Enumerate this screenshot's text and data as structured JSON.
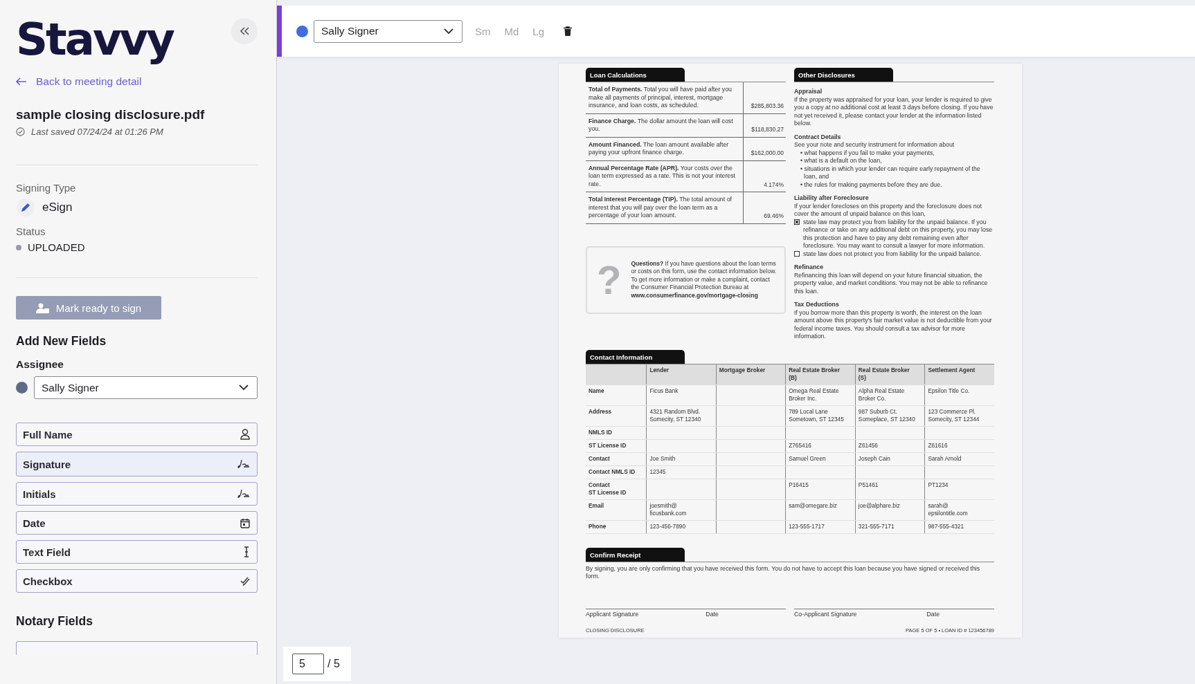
{
  "sidebar": {
    "logo": "Stavvy",
    "back_link": "Back to meeting detail",
    "document_name": "sample closing disclosure.pdf",
    "last_saved": "Last saved 07/24/24 at 01:26 PM",
    "signing_type_label": "Signing Type",
    "signing_type": "eSign",
    "status_label": "Status",
    "status": "UPLOADED",
    "mark_ready_button": {
      "label": "Mark ready to sign",
      "disabled": true
    },
    "add_fields_heading": "Add New Fields",
    "assignee_label": "Assignee",
    "assignee": "Sally Signer",
    "fields": [
      {
        "label": "Full Name",
        "kind": "name",
        "hovered": false
      },
      {
        "label": "Signature",
        "kind": "signature",
        "hovered": true
      },
      {
        "label": "Initials",
        "kind": "initials",
        "hovered": false
      },
      {
        "label": "Date",
        "kind": "date",
        "hovered": false
      },
      {
        "label": "Text Field",
        "kind": "text",
        "hovered": false
      },
      {
        "label": "Checkbox",
        "kind": "checkbox",
        "hovered": false
      }
    ],
    "notary_heading": "Notary Fields"
  },
  "toolbar": {
    "assignee": "Sally Signer",
    "sizes": [
      {
        "label": "Sm",
        "disabled": true
      },
      {
        "label": "Md",
        "disabled": true
      },
      {
        "label": "Lg",
        "disabled": true
      }
    ]
  },
  "document": {
    "loan_calculations": {
      "title": "Loan Calculations",
      "rows": [
        {
          "text": "**Total of Payments.** Total you will have paid after you make all payments of principal, interest, mortgage insurance, and loan costs, as scheduled.",
          "value": "$285,803.36"
        },
        {
          "text": "**Finance Charge.** The dollar amount the loan will cost you.",
          "value": "$118,830.27"
        },
        {
          "text": "**Amount Financed.** The loan amount available after paying your upfront finance charge.",
          "value": "$162,000.00"
        },
        {
          "text": "**Annual Percentage Rate (APR).** Your costs over the loan term expressed as a rate. This is not your interest rate.",
          "value": "4.174%"
        },
        {
          "text": "**Total Interest Percentage (TIP).** The total amount of interest that you will pay over the loan term as a percentage of your loan amount.",
          "value": "69.46%"
        }
      ]
    },
    "questions": {
      "mark": "?",
      "text": "**Questions?** If you have questions about the loan terms or costs on this form, use the contact information below. To get more information or make a complaint, contact the Consumer Financial Protection Bureau at **www.consumerfinance.gov/mortgage-closing**"
    },
    "other_disclosures": {
      "title": "Other Disclosures",
      "sections": [
        {
          "heading": "Appraisal",
          "text": "If the property was appraised for your loan, your lender is required to give you a copy at no additional cost at least 3 days before closing. If you have not yet received it, please contact your lender at the information listed below."
        },
        {
          "heading": "Contract Details",
          "text": "See your note and security instrument for information about",
          "bullets": [
            "• what happens if you fail to make your payments,",
            "• what is a default on the loan,",
            "• situations in which your lender can require early repayment of the loan, and",
            "• the rules for making payments before they are due."
          ]
        },
        {
          "heading": "Liability after Foreclosure",
          "text": "If your lender forecloses on this property and the foreclosure does not cover the amount of unpaid balance on this loan,",
          "options": [
            {
              "text": "state law may protect you from liability for the unpaid balance. If you refinance or take on any additional debt on this property, you may lose this protection and have to pay any debt remaining even after foreclosure. You may want to consult a lawyer for more information.",
              "checked": true
            },
            {
              "text": "state law does not protect you from liability for the unpaid balance.",
              "checked": false
            }
          ]
        },
        {
          "heading": "Refinance",
          "text": "Refinancing this loan will depend on your future financial situation, the property value, and market conditions. You may not be able to refinance this loan."
        },
        {
          "heading": "Tax Deductions",
          "text": "If you borrow more than this property is worth, the interest on the loan amount above this property's fair market value is not deductible from your federal income taxes. You should consult a tax advisor for more information."
        }
      ]
    },
    "contact_information": {
      "title": "Contact Information",
      "columns": [
        "Lender",
        "Mortgage Broker",
        "Real Estate Broker\n(B)",
        "Real Estate Broker\n(S)",
        "Settlement Agent"
      ],
      "rows": [
        {
          "label": "Name",
          "cells": [
            "Ficus Bank",
            null,
            "Omega Real Estate\nBroker Inc.",
            "Alpha Real Estate\nBroker Co.",
            "Epsilon Title Co."
          ]
        },
        {
          "label": "Address",
          "cells": [
            "4321 Random Blvd.\nSomecity, ST 12340",
            null,
            "789 Local Lane\nSometown, ST 12345",
            "987 Suburb Ct.\nSomeplace, ST 12340",
            "123 Commerce Pl.\nSomecity, ST 12344"
          ]
        },
        {
          "label": "NMLS ID",
          "cells": [
            null,
            null,
            null,
            null,
            null
          ]
        },
        {
          "label": "ST License ID",
          "cells": [
            null,
            null,
            "Z765416",
            "Z61456",
            "Z61616"
          ]
        },
        {
          "label": "Contact",
          "cells": [
            "Joe Smith",
            null,
            "Samuel Green",
            "Joseph Cain",
            "Sarah Arnold"
          ]
        },
        {
          "label": "Contact NMLS ID",
          "cells": [
            "12345",
            null,
            null,
            null,
            null
          ]
        },
        {
          "label": "Contact\nST License ID",
          "cells": [
            null,
            null,
            "P16415",
            "P51461",
            "PT1234"
          ]
        },
        {
          "label": "Email",
          "cells": [
            "joesmith@\nficusbank.com",
            null,
            "sam@omegare.biz",
            "joe@alphare.biz",
            "sarah@\nepsilontitle.com"
          ]
        },
        {
          "label": "Phone",
          "cells": [
            "123-456-7890",
            null,
            "123-555-1717",
            "321-555-7171",
            "987-555-4321"
          ]
        }
      ]
    },
    "confirm_receipt": {
      "title": "Confirm Receipt",
      "text": "By signing, you are only confirming that you have received this form. You do not have to accept this loan because you have signed or received this form.",
      "signatures": [
        {
          "label": "Applicant Signature",
          "date_label": "Date"
        },
        {
          "label": "Co-Applicant Signature",
          "date_label": "Date"
        }
      ]
    },
    "footer_left": "CLOSING DISCLOSURE",
    "footer_right": "PAGE 5 OF 5 • LOAN ID # 123456789"
  },
  "pager": {
    "page": "5",
    "total": "/ 5"
  }
}
